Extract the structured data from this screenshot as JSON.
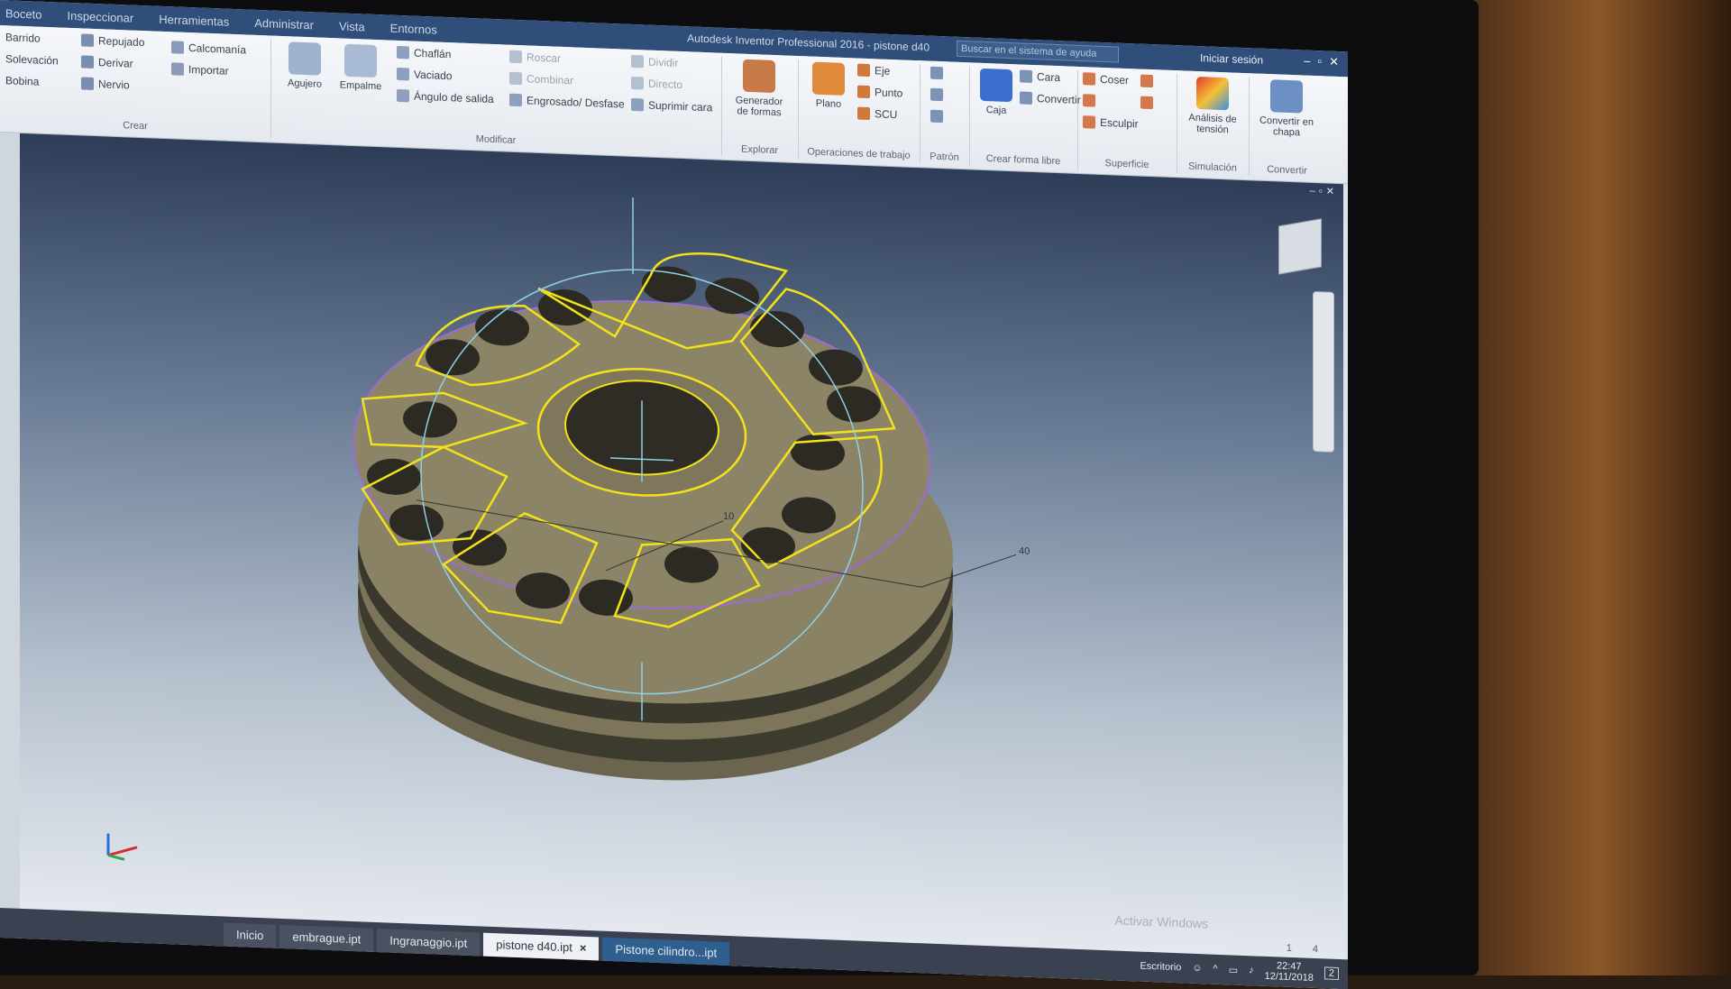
{
  "menubar": {
    "tabs": [
      "Boceto",
      "Inspeccionar",
      "Herramientas",
      "Administrar",
      "Vista",
      "Entornos"
    ],
    "title": "Autodesk Inventor Professional 2016 - pistone d40",
    "search_placeholder": "Buscar en el sistema de ayuda",
    "user": "Iniciar sesión"
  },
  "ribbon": {
    "crear": {
      "label": "Crear",
      "items": [
        "Barrido",
        "Solevación",
        "Bobina",
        "Repujado",
        "Derivar",
        "Nervio",
        "Calcomanía",
        "Importar"
      ]
    },
    "modificar": {
      "label": "Modificar",
      "big": [
        "Agujero",
        "Empalme"
      ],
      "items": [
        "Chaflán",
        "Vaciado",
        "Ángulo de salida",
        "Roscar",
        "Combinar",
        "Engrosado/ Desfase",
        "Dividir",
        "Directo",
        "Suprimir cara"
      ]
    },
    "explorar": {
      "label": "Explorar",
      "big": "Generador de formas"
    },
    "trabajo": {
      "label": "Operaciones de trabajo",
      "big": "Plano",
      "items": [
        "Eje",
        "Punto",
        "SCU"
      ]
    },
    "patron": {
      "label": "Patrón"
    },
    "forma_libre": {
      "label": "Crear forma libre",
      "big": "Caja",
      "items": [
        "Cara",
        "Convertir"
      ]
    },
    "superficie": {
      "label": "Superficie",
      "items": [
        "Coser",
        "Esculpir"
      ]
    },
    "simulacion": {
      "label": "Simulación",
      "big": "Análisis de tensión"
    },
    "convertir": {
      "label": "Convertir",
      "big": "Convertir en chapa"
    }
  },
  "viewport": {
    "dimension_labels": [
      "10",
      "40"
    ],
    "watermark": "Activar Windows"
  },
  "doc_tabs": [
    "Inicio",
    "embrague.ipt",
    "Ingranaggio.ipt",
    "pistone d40.ipt",
    "Pistone cilindro...ipt"
  ],
  "doc_tab_close": "×",
  "taskbar": {
    "location": "Escritorio",
    "time": "22:47",
    "date": "12/11/2018",
    "notifications": "2"
  },
  "page_indicator": [
    "1",
    "4"
  ],
  "colors": {
    "menubar": "#2f4e7a",
    "part_face": "#8c8466",
    "selection_edge": "#f2e21a",
    "purple_edge": "#9b6bd6"
  }
}
